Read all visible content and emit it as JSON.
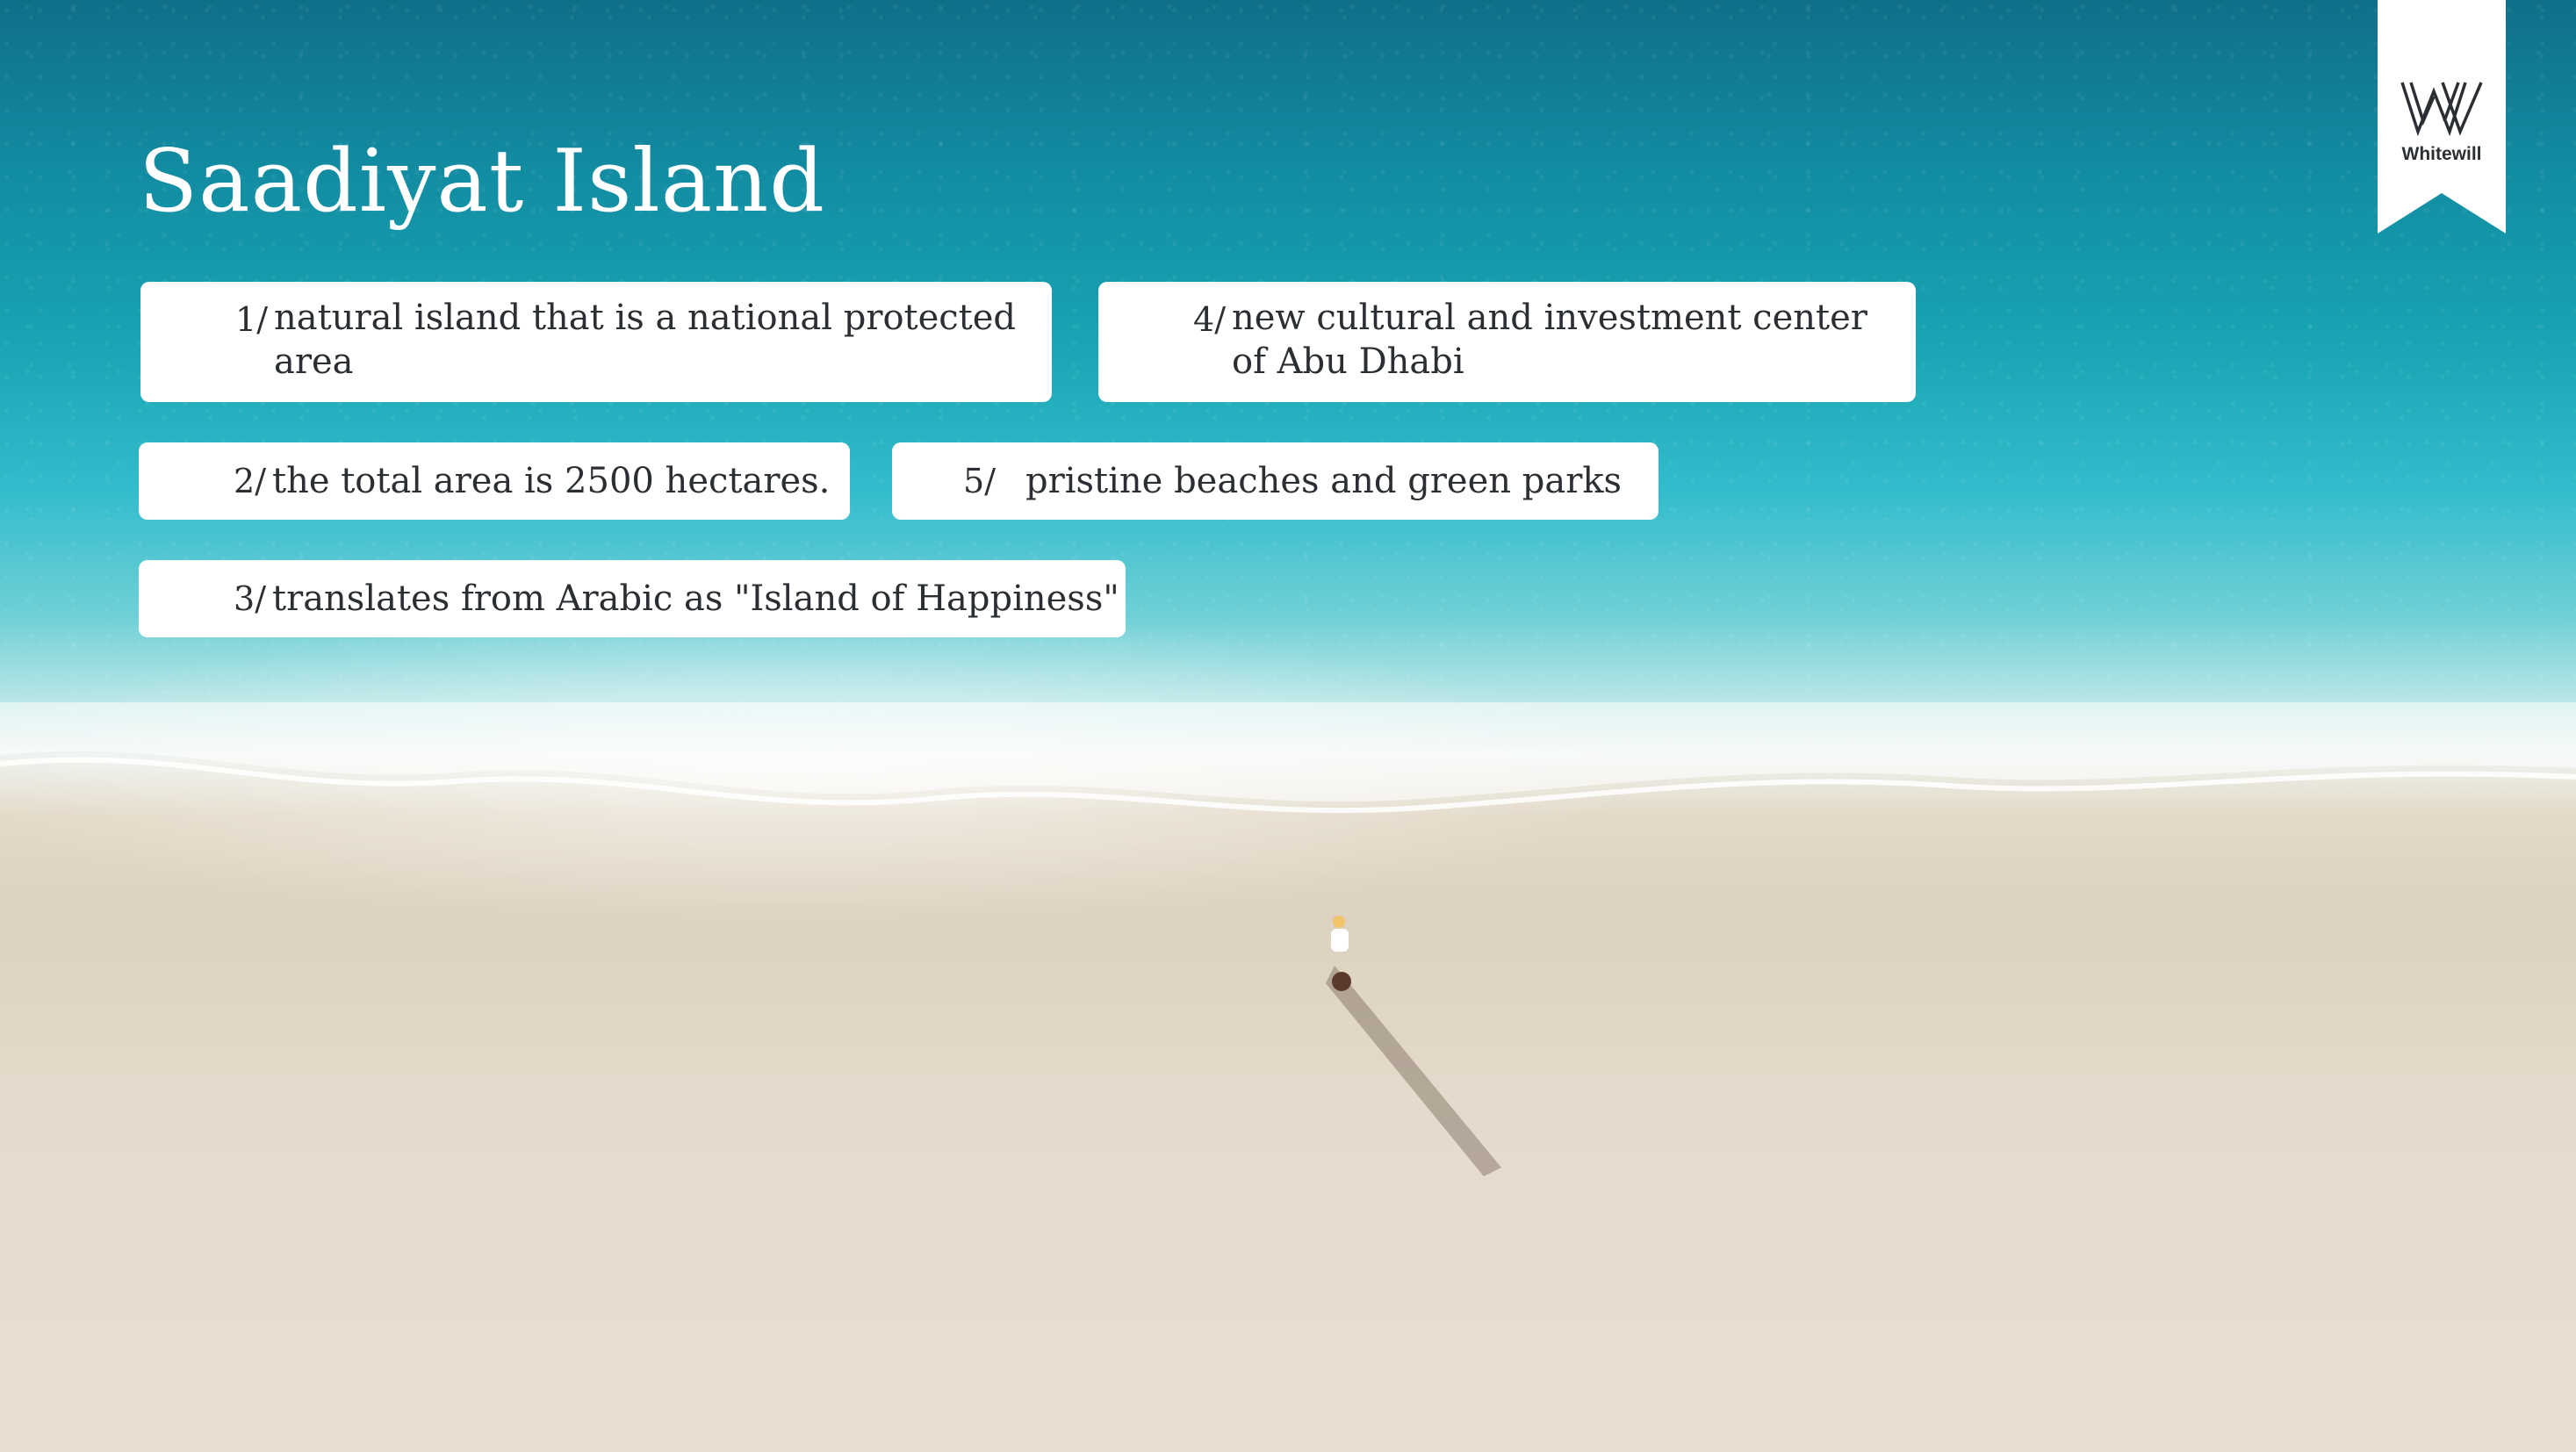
{
  "slide": {
    "title": "Saadiyat Island",
    "brand": {
      "name": "Whitewill",
      "mark_icon": "whitewill-w-logo-icon"
    },
    "facts": [
      {
        "num": "1/",
        "text": "natural island that is a national protected area"
      },
      {
        "num": "2/",
        "text": "the total area is 2500 hectares."
      },
      {
        "num": "3/",
        "text": "translates from Arabic as \"Island of Happiness\""
      },
      {
        "num": "4/",
        "text": "new cultural and investment center of Abu Dhabi"
      },
      {
        "num": "5/",
        "text": "pristine beaches and green parks"
      }
    ],
    "background": {
      "description_icon": "aerial-beach-photo",
      "water_color": "#17a3b2",
      "sand_color": "#e3d9c7"
    }
  }
}
